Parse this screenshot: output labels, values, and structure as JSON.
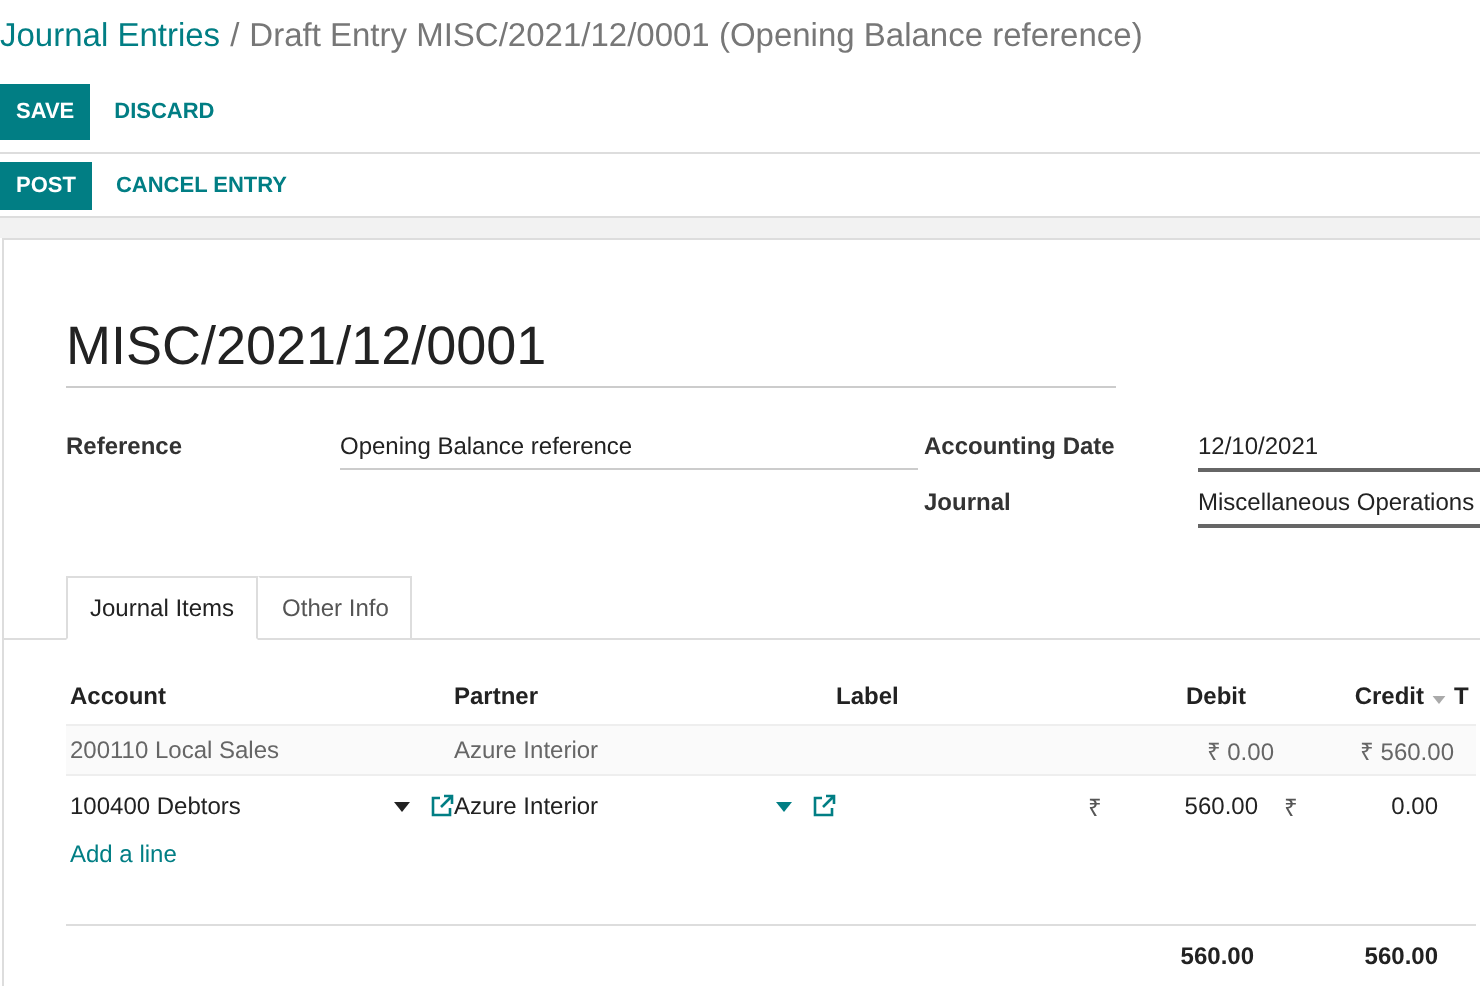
{
  "breadcrumb": {
    "parent": "Journal Entries",
    "separator": "/",
    "current": "Draft Entry MISC/2021/12/0001 (Opening Balance reference)"
  },
  "edit_buttons": [
    {
      "label": "SAVE",
      "kind": "primary"
    },
    {
      "label": "DISCARD",
      "kind": "link"
    }
  ],
  "status_buttons": [
    {
      "label": "POST",
      "kind": "primary"
    },
    {
      "label": "CANCEL ENTRY",
      "kind": "link"
    }
  ],
  "entry_name": "MISC/2021/12/0001",
  "fields_left": [
    {
      "label": "Reference",
      "value": "Opening Balance reference"
    }
  ],
  "fields_right": [
    {
      "label": "Accounting Date",
      "value": "12/10/2021"
    },
    {
      "label": "Journal",
      "value": "Miscellaneous Operations"
    }
  ],
  "tabs": [
    {
      "label": "Journal Items",
      "selected": true
    },
    {
      "label": "Other Info",
      "selected": false
    }
  ],
  "table": {
    "columns": [
      {
        "label": "Account",
        "sorted": false
      },
      {
        "label": "Partner",
        "sorted": false
      },
      {
        "label": "Label",
        "sorted": false
      },
      {
        "label": "Debit",
        "sorted": false
      },
      {
        "label": "Credit",
        "sorted": true
      },
      {
        "label": "T",
        "sorted": false
      }
    ],
    "rows": [
      {
        "editing": false,
        "account": "200110 Local Sales",
        "partner": "Azure Interior",
        "debit": "₹ 0.00",
        "credit": "₹ 560.00"
      },
      {
        "editing": true,
        "account": "100400 Debtors",
        "partner": "Azure Interior",
        "debit_currency": "₹",
        "debit": "560.00",
        "credit_currency": "₹",
        "credit": "0.00"
      }
    ],
    "add_line": "Add a line",
    "totals": {
      "debit": "560.00",
      "credit": "560.00"
    }
  }
}
